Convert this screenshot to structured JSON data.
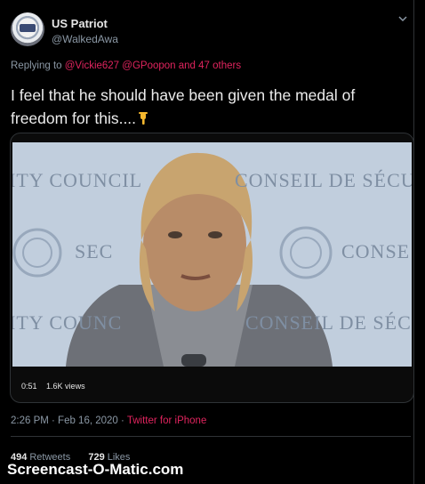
{
  "user": {
    "name": "US Patriot",
    "handle": "@WalkedAwa"
  },
  "reply": {
    "prefix": "Replying to",
    "mentions": "@Vickie627 @GPoopon and 47 others"
  },
  "tweet": {
    "text": "I feel that he should have been given the medal of freedom for this....",
    "emoji": "pointing-down-hand-emoji"
  },
  "video": {
    "backdrop_text_1": "ITY COUNCIL",
    "backdrop_text_2": "CONSEIL DE SÉCURIT",
    "backdrop_text_3": "SEC",
    "backdrop_text_4": "CONSE",
    "backdrop_text_5": "ITY COUNC",
    "backdrop_text_6": "CONSEIL DE SÉCURIT",
    "duration": "0:51",
    "views": "1.6K views"
  },
  "meta": {
    "timestamp": "2:26 PM · Feb 16, 2020 ·",
    "source": "Twitter for iPhone"
  },
  "stats": {
    "retweets_count": "494",
    "retweets_label": "Retweets",
    "likes_count": "729",
    "likes_label": "Likes"
  },
  "watermark": "Screencast-O-Matic.com",
  "colors": {
    "background": "#000000",
    "accent": "#e0245e",
    "secondary_text": "#8b98a5"
  }
}
